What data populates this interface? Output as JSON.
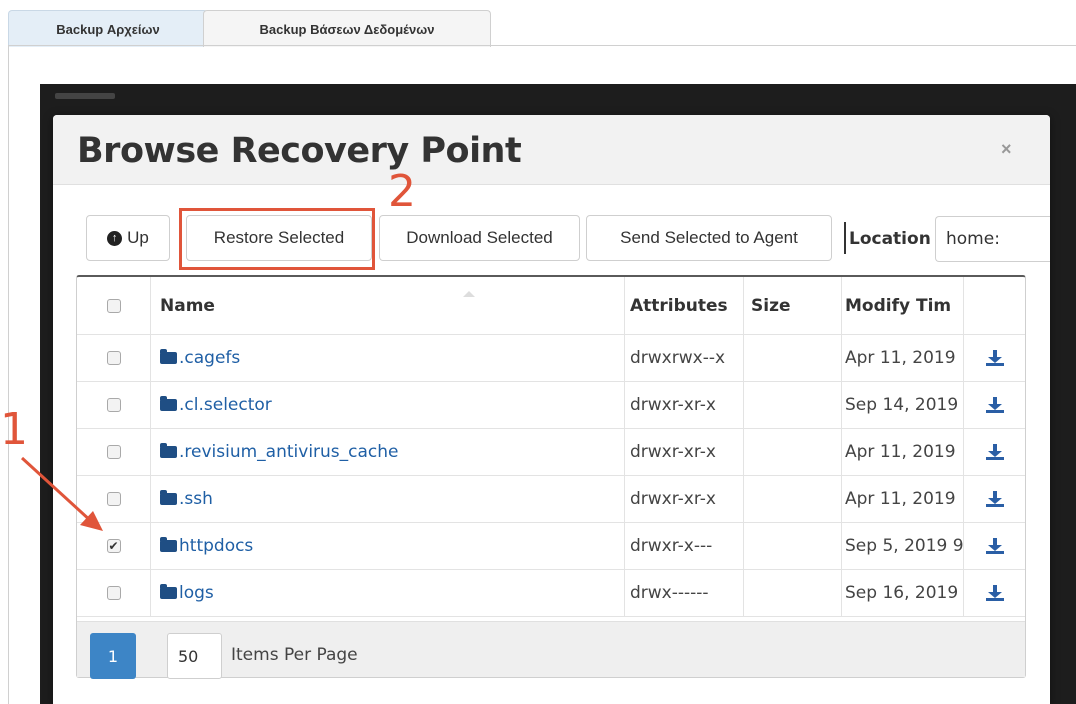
{
  "tabs": [
    {
      "label": "Backup Αρχείων",
      "active": true
    },
    {
      "label": "Backup Βάσεων Δεδομένων",
      "active": false
    }
  ],
  "modal": {
    "title": "Browse Recovery Point",
    "close": "×"
  },
  "toolbar": {
    "up_label": "Up",
    "restore_label": "Restore Selected",
    "download_label": "Download Selected",
    "send_label": "Send Selected to Agent",
    "location_label": "Location",
    "location_value": "home:"
  },
  "table": {
    "headers": {
      "name": "Name",
      "attributes": "Attributes",
      "size": "Size",
      "modify": "Modify Tim"
    },
    "rows": [
      {
        "name": ".cagefs",
        "attributes": "drwxrwx--x",
        "size": "",
        "modify": "Apr 11, 2019",
        "checked": false
      },
      {
        "name": ".cl.selector",
        "attributes": "drwxr-xr-x",
        "size": "",
        "modify": "Sep 14, 2019",
        "checked": false
      },
      {
        "name": ".revisium_antivirus_cache",
        "attributes": "drwxr-xr-x",
        "size": "",
        "modify": "Apr 11, 2019",
        "checked": false
      },
      {
        "name": ".ssh",
        "attributes": "drwxr-xr-x",
        "size": "",
        "modify": "Apr 11, 2019",
        "checked": false
      },
      {
        "name": "httpdocs",
        "attributes": "drwxr-x---",
        "size": "",
        "modify": "Sep 5, 2019 9",
        "checked": true
      },
      {
        "name": "logs",
        "attributes": "drwx------",
        "size": "",
        "modify": "Sep 16, 2019",
        "checked": false
      }
    ]
  },
  "pagination": {
    "current_page": "1",
    "items_per_page": "50",
    "items_per_page_label": "Items Per Page"
  },
  "annotations": {
    "label_1": "1",
    "label_2": "2",
    "color": "#e0553a"
  }
}
